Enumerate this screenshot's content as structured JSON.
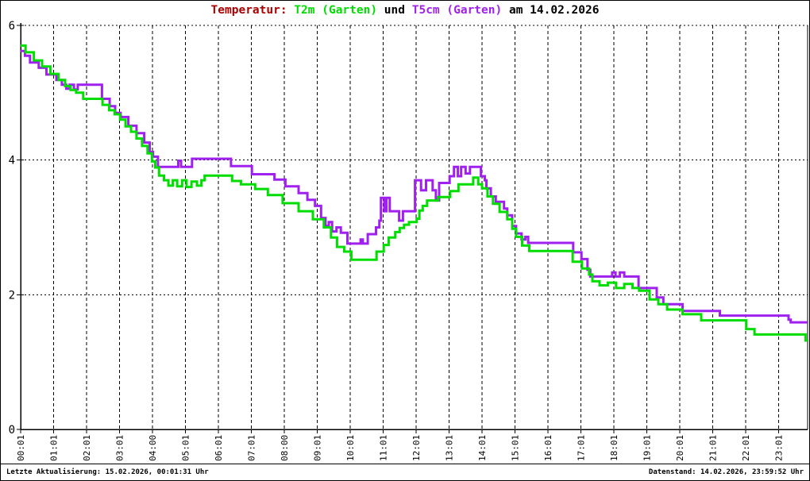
{
  "title": {
    "prefix": "Temperatur: ",
    "series1": "T2m (Garten)",
    "conjunction": " und ",
    "series2": "T5cm (Garten)",
    "suffix": " am 14.02.2026"
  },
  "colors": {
    "title_prefix": "#aa0000",
    "t2m": "#00dd00",
    "t5cm": "#a020f0",
    "axis": "#000000",
    "background": "#ffffff"
  },
  "status_bar": {
    "left": "Letzte Aktualisierung: 15.02.2026, 00:01:31 Uhr",
    "right": "Datenstand: 14.02.2026, 23:59:52 Uhr"
  },
  "chart_data": {
    "type": "line",
    "step": "after",
    "title": "Temperatur: T2m (Garten) und T5cm (Garten) am 14.02.2026",
    "xlabel": "",
    "ylabel": "",
    "ylim": [
      0,
      6
    ],
    "yticks": [
      0,
      2,
      4,
      6
    ],
    "grid": true,
    "x_start": "00:01",
    "x_end": "23:54",
    "xticks": [
      "00:01",
      "01:01",
      "02:01",
      "03:01",
      "04:00",
      "05:01",
      "06:01",
      "07:01",
      "08:00",
      "09:01",
      "10:01",
      "11:01",
      "12:01",
      "13:01",
      "14:01",
      "15:01",
      "16:01",
      "17:01",
      "18:01",
      "19:01",
      "20:01",
      "21:01",
      "22:01",
      "23:01"
    ],
    "series": [
      {
        "name": "T5cm (Garten)",
        "color": "#a020f0",
        "points": [
          [
            "00:01",
            5.62
          ],
          [
            "00:09",
            5.55
          ],
          [
            "00:18",
            5.45
          ],
          [
            "00:34",
            5.37
          ],
          [
            "00:48",
            5.27
          ],
          [
            "01:06",
            5.19
          ],
          [
            "01:16",
            5.12
          ],
          [
            "01:24",
            5.06
          ],
          [
            "01:30",
            5.12
          ],
          [
            "01:38",
            5.05
          ],
          [
            "01:45",
            5.12
          ],
          [
            "02:29",
            4.91
          ],
          [
            "02:43",
            4.8
          ],
          [
            "02:53",
            4.7
          ],
          [
            "03:03",
            4.64
          ],
          [
            "03:17",
            4.51
          ],
          [
            "03:32",
            4.4
          ],
          [
            "03:46",
            4.26
          ],
          [
            "03:56",
            4.12
          ],
          [
            "04:02",
            4.05
          ],
          [
            "04:11",
            3.9
          ],
          [
            "04:48",
            3.99
          ],
          [
            "04:53",
            3.9
          ],
          [
            "05:13",
            4.02
          ],
          [
            "06:24",
            3.91
          ],
          [
            "07:02",
            3.79
          ],
          [
            "07:43",
            3.71
          ],
          [
            "08:03",
            3.61
          ],
          [
            "08:27",
            3.51
          ],
          [
            "08:43",
            3.41
          ],
          [
            "08:57",
            3.32
          ],
          [
            "09:08",
            3.14
          ],
          [
            "09:16",
            3.02
          ],
          [
            "09:22",
            3.08
          ],
          [
            "09:28",
            2.94
          ],
          [
            "09:36",
            3.0
          ],
          [
            "09:44",
            2.92
          ],
          [
            "09:56",
            2.76
          ],
          [
            "10:20",
            2.82
          ],
          [
            "10:24",
            2.76
          ],
          [
            "10:33",
            2.9
          ],
          [
            "10:48",
            3.0
          ],
          [
            "10:54",
            3.1
          ],
          [
            "10:57",
            3.44
          ],
          [
            "11:03",
            3.24
          ],
          [
            "11:07",
            3.44
          ],
          [
            "11:13",
            3.24
          ],
          [
            "11:30",
            3.1
          ],
          [
            "11:37",
            3.24
          ],
          [
            "11:59",
            3.7
          ],
          [
            "12:10",
            3.55
          ],
          [
            "12:19",
            3.7
          ],
          [
            "12:31",
            3.55
          ],
          [
            "12:37",
            3.4
          ],
          [
            "12:43",
            3.66
          ],
          [
            "13:02",
            3.76
          ],
          [
            "13:10",
            3.9
          ],
          [
            "13:17",
            3.76
          ],
          [
            "13:23",
            3.9
          ],
          [
            "13:31",
            3.8
          ],
          [
            "13:39",
            3.9
          ],
          [
            "13:59",
            3.76
          ],
          [
            "14:06",
            3.7
          ],
          [
            "14:09",
            3.58
          ],
          [
            "14:17",
            3.46
          ],
          [
            "14:26",
            3.38
          ],
          [
            "14:41",
            3.28
          ],
          [
            "14:47",
            3.18
          ],
          [
            "14:56",
            3.02
          ],
          [
            "15:03",
            2.91
          ],
          [
            "15:13",
            2.82
          ],
          [
            "15:20",
            2.86
          ],
          [
            "15:25",
            2.77
          ],
          [
            "16:47",
            2.63
          ],
          [
            "17:02",
            2.53
          ],
          [
            "17:13",
            2.37
          ],
          [
            "17:18",
            2.27
          ],
          [
            "17:58",
            2.33
          ],
          [
            "18:04",
            2.27
          ],
          [
            "18:12",
            2.33
          ],
          [
            "18:20",
            2.27
          ],
          [
            "18:46",
            2.1
          ],
          [
            "19:19",
            1.96
          ],
          [
            "19:31",
            1.86
          ],
          [
            "20:06",
            1.76
          ],
          [
            "21:14",
            1.69
          ],
          [
            "23:19",
            1.63
          ],
          [
            "23:23",
            1.59
          ]
        ]
      },
      {
        "name": "T2m (Garten)",
        "color": "#00dd00",
        "points": [
          [
            "00:01",
            5.7
          ],
          [
            "00:10",
            5.6
          ],
          [
            "00:25",
            5.48
          ],
          [
            "00:40",
            5.39
          ],
          [
            "00:55",
            5.28
          ],
          [
            "01:10",
            5.19
          ],
          [
            "01:22",
            5.1
          ],
          [
            "01:32",
            5.04
          ],
          [
            "01:42",
            5.0
          ],
          [
            "01:55",
            4.91
          ],
          [
            "02:30",
            4.82
          ],
          [
            "02:42",
            4.74
          ],
          [
            "02:52",
            4.68
          ],
          [
            "03:02",
            4.6
          ],
          [
            "03:12",
            4.5
          ],
          [
            "03:22",
            4.42
          ],
          [
            "03:32",
            4.32
          ],
          [
            "03:42",
            4.21
          ],
          [
            "03:52",
            4.1
          ],
          [
            "04:00",
            3.98
          ],
          [
            "04:06",
            3.89
          ],
          [
            "04:13",
            3.77
          ],
          [
            "04:22",
            3.7
          ],
          [
            "04:30",
            3.62
          ],
          [
            "04:38",
            3.7
          ],
          [
            "04:46",
            3.61
          ],
          [
            "04:55",
            3.7
          ],
          [
            "05:03",
            3.6
          ],
          [
            "05:12",
            3.68
          ],
          [
            "05:22",
            3.62
          ],
          [
            "05:30",
            3.7
          ],
          [
            "05:36",
            3.77
          ],
          [
            "06:26",
            3.69
          ],
          [
            "06:42",
            3.64
          ],
          [
            "07:08",
            3.57
          ],
          [
            "07:31",
            3.48
          ],
          [
            "07:58",
            3.36
          ],
          [
            "08:27",
            3.24
          ],
          [
            "08:53",
            3.12
          ],
          [
            "09:13",
            3.0
          ],
          [
            "09:26",
            2.85
          ],
          [
            "09:37",
            2.71
          ],
          [
            "09:50",
            2.64
          ],
          [
            "10:03",
            2.52
          ],
          [
            "10:49",
            2.64
          ],
          [
            "11:02",
            2.74
          ],
          [
            "11:11",
            2.85
          ],
          [
            "11:23",
            2.93
          ],
          [
            "11:31",
            2.99
          ],
          [
            "11:39",
            3.04
          ],
          [
            "11:48",
            3.08
          ],
          [
            "12:02",
            3.13
          ],
          [
            "12:07",
            3.25
          ],
          [
            "12:13",
            3.32
          ],
          [
            "12:21",
            3.4
          ],
          [
            "12:41",
            3.45
          ],
          [
            "13:03",
            3.54
          ],
          [
            "13:18",
            3.64
          ],
          [
            "13:45",
            3.74
          ],
          [
            "13:54",
            3.64
          ],
          [
            "14:01",
            3.58
          ],
          [
            "14:11",
            3.46
          ],
          [
            "14:21",
            3.35
          ],
          [
            "14:33",
            3.23
          ],
          [
            "14:47",
            3.12
          ],
          [
            "14:56",
            2.98
          ],
          [
            "15:03",
            2.86
          ],
          [
            "15:14",
            2.73
          ],
          [
            "15:27",
            2.65
          ],
          [
            "16:46",
            2.49
          ],
          [
            "17:03",
            2.39
          ],
          [
            "17:16",
            2.3
          ],
          [
            "17:22",
            2.2
          ],
          [
            "17:35",
            2.14
          ],
          [
            "17:50",
            2.18
          ],
          [
            "18:05",
            2.1
          ],
          [
            "18:20",
            2.16
          ],
          [
            "18:35",
            2.1
          ],
          [
            "18:47",
            2.06
          ],
          [
            "19:06",
            1.93
          ],
          [
            "19:22",
            1.86
          ],
          [
            "19:38",
            1.78
          ],
          [
            "20:06",
            1.71
          ],
          [
            "20:40",
            1.62
          ],
          [
            "22:02",
            1.49
          ],
          [
            "22:17",
            1.41
          ],
          [
            "23:50",
            1.32
          ]
        ]
      }
    ]
  }
}
